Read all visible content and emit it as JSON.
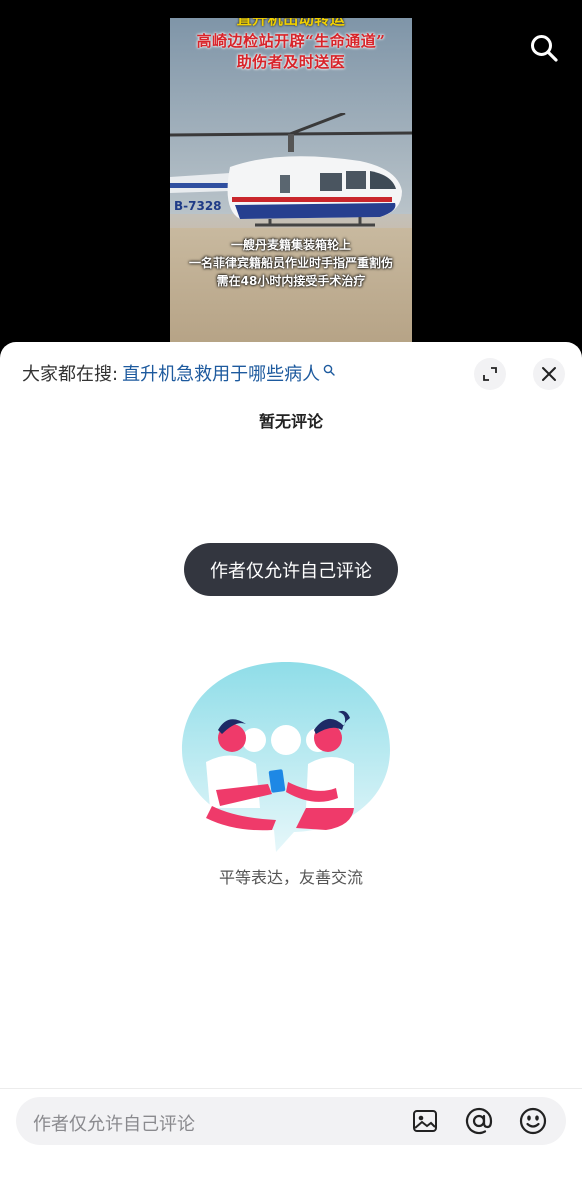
{
  "video": {
    "title_lines": [
      "直升机出动转运",
      "高崎边检站开辟“生命通道”",
      "助伤者及时送医"
    ],
    "captions": [
      "一艘丹麦籍集装箱轮上",
      "一名菲律宾籍船员作业时手指严重割伤",
      "需在48小时内接受手术治疗"
    ],
    "tail_number": "B-7328",
    "search_icon": "search-icon"
  },
  "comments": {
    "hot_search_prefix": "大家都在搜:",
    "hot_search_query": "直升机急救用于哪些病人",
    "empty_title": "暂无评论",
    "toast": "作者仅允许自己评论",
    "slogan": "平等表达，友善交流"
  },
  "input": {
    "placeholder": "作者仅允许自己评论",
    "icons": [
      "image-icon",
      "at-icon",
      "emoji-icon"
    ]
  },
  "colors": {
    "accent_link": "#1d5a9e",
    "toast_bg": "#33363f",
    "illustration_teal": "#7fd4e0",
    "illustration_pink": "#ef3a6a"
  }
}
